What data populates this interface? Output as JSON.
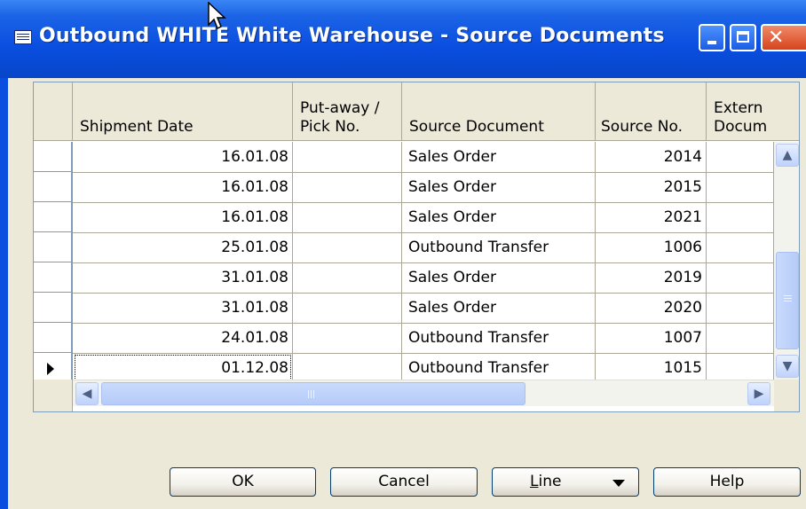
{
  "window": {
    "title": "Outbound WHITE White Warehouse - Source Documents",
    "title_icon": "list-form-icon",
    "colors": {
      "titlebar": "#0a4ee0",
      "client": "#ece9d8",
      "close_button": "#d6441c"
    }
  },
  "grid": {
    "columns": [
      "Shipment Date",
      "Put-away /\nPick No.",
      "Source Document",
      "Source No.",
      "Extern\nDocum"
    ],
    "rows": [
      {
        "shipment_date": "16.01.08",
        "pick_no": "",
        "source_document": "Sales Order",
        "source_no": "2014",
        "external_doc": ""
      },
      {
        "shipment_date": "16.01.08",
        "pick_no": "",
        "source_document": "Sales Order",
        "source_no": "2015",
        "external_doc": ""
      },
      {
        "shipment_date": "16.01.08",
        "pick_no": "",
        "source_document": "Sales Order",
        "source_no": "2021",
        "external_doc": ""
      },
      {
        "shipment_date": "25.01.08",
        "pick_no": "",
        "source_document": "Outbound Transfer",
        "source_no": "1006",
        "external_doc": ""
      },
      {
        "shipment_date": "31.01.08",
        "pick_no": "",
        "source_document": "Sales Order",
        "source_no": "2019",
        "external_doc": ""
      },
      {
        "shipment_date": "31.01.08",
        "pick_no": "",
        "source_document": "Sales Order",
        "source_no": "2020",
        "external_doc": ""
      },
      {
        "shipment_date": "24.01.08",
        "pick_no": "",
        "source_document": "Outbound Transfer",
        "source_no": "1007",
        "external_doc": ""
      },
      {
        "shipment_date": "01.12.08",
        "pick_no": "",
        "source_document": "Outbound Transfer",
        "source_no": "1015",
        "external_doc": ""
      }
    ],
    "selected_row": 7
  },
  "buttons": {
    "ok": "OK",
    "cancel": "Cancel",
    "line_first": "L",
    "line_rest": "ine",
    "help": "Help"
  }
}
